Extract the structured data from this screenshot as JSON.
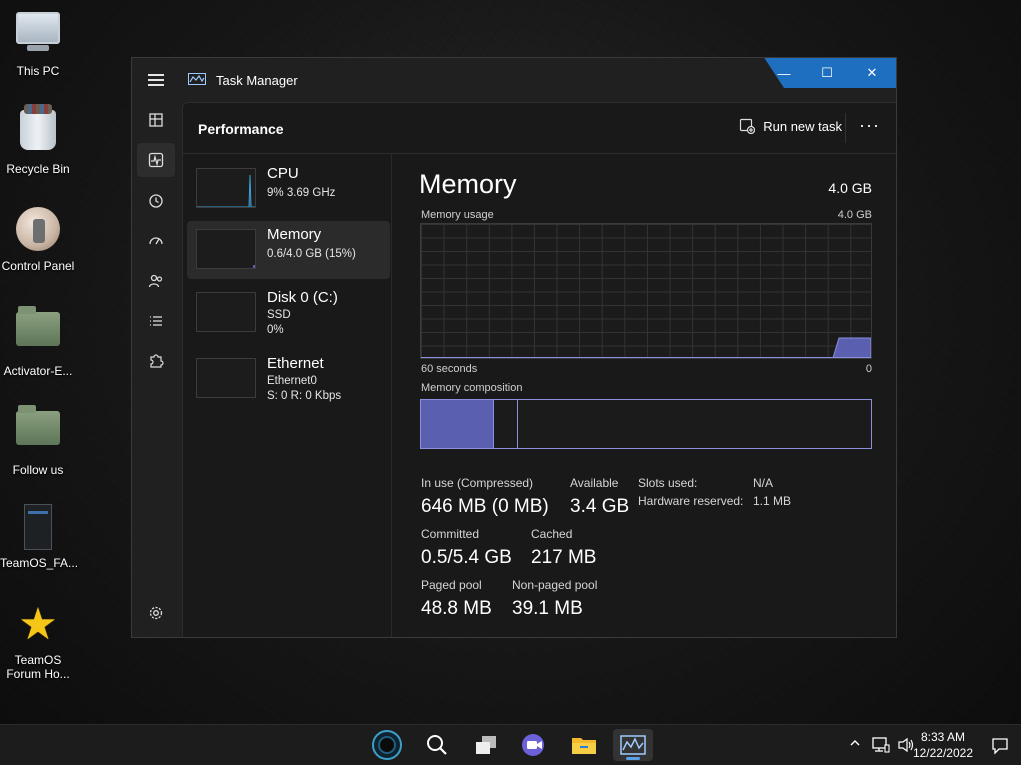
{
  "desktop": {
    "icons": [
      {
        "label": "This PC"
      },
      {
        "label": "Recycle Bin"
      },
      {
        "label": "Control Panel"
      },
      {
        "label": "Activator-E..."
      },
      {
        "label": "Follow us"
      },
      {
        "label": "TeamOS_FA..."
      },
      {
        "label": "TeamOS\nForum Ho..."
      }
    ]
  },
  "window": {
    "title": "Task Manager",
    "controls": {
      "minimize": "—",
      "maximize": "☐",
      "close": "✕"
    }
  },
  "nav": {
    "items": [
      "processes-icon",
      "performance-icon",
      "app-history-icon",
      "startup-icon",
      "users-icon",
      "details-icon",
      "services-icon",
      "settings-icon"
    ],
    "active": "performance-icon"
  },
  "header": {
    "page_title": "Performance",
    "run_new_task": "Run new task",
    "more": "···"
  },
  "perf_list": [
    {
      "name": "CPU",
      "line1": "9%  3.69 GHz",
      "line2": ""
    },
    {
      "name": "Memory",
      "line1": "0.6/4.0 GB (15%)",
      "line2": ""
    },
    {
      "name": "Disk 0 (C:)",
      "line1": "SSD",
      "line2": "0%"
    },
    {
      "name": "Ethernet",
      "line1": "Ethernet0",
      "line2": "S: 0 R: 0 Kbps"
    }
  ],
  "detail": {
    "title": "Memory",
    "total": "4.0 GB",
    "usage_label": "Memory usage",
    "usage_max": "4.0 GB",
    "time_label": "60 seconds",
    "time_min": "0",
    "composition_label": "Memory composition",
    "composition": {
      "in_use_fraction": 0.16,
      "modified_fraction": 0.05
    },
    "stats": {
      "in_use_label": "In use (Compressed)",
      "in_use_value": "646 MB (0 MB)",
      "available_label": "Available",
      "available_value": "3.4 GB",
      "committed_label": "Committed",
      "committed_value": "0.5/5.4 GB",
      "cached_label": "Cached",
      "cached_value": "217 MB",
      "paged_label": "Paged pool",
      "paged_value": "48.8 MB",
      "nonpaged_label": "Non-paged pool",
      "nonpaged_value": "39.1 MB",
      "slots_label": "Slots used:",
      "slots_value": "N/A",
      "hwres_label": "Hardware reserved:",
      "hwres_value": "1.1 MB"
    }
  },
  "taskbar": {
    "apps": [
      "start-icon",
      "search-icon",
      "task-view-icon",
      "chat-icon",
      "file-explorer-icon",
      "task-manager-icon"
    ],
    "time": "8:33 AM",
    "date": "12/22/2022"
  },
  "colors": {
    "accent": "#1e6fbf",
    "memory_fill": "#5a5fb0",
    "memory_line": "#8a8fe0"
  }
}
